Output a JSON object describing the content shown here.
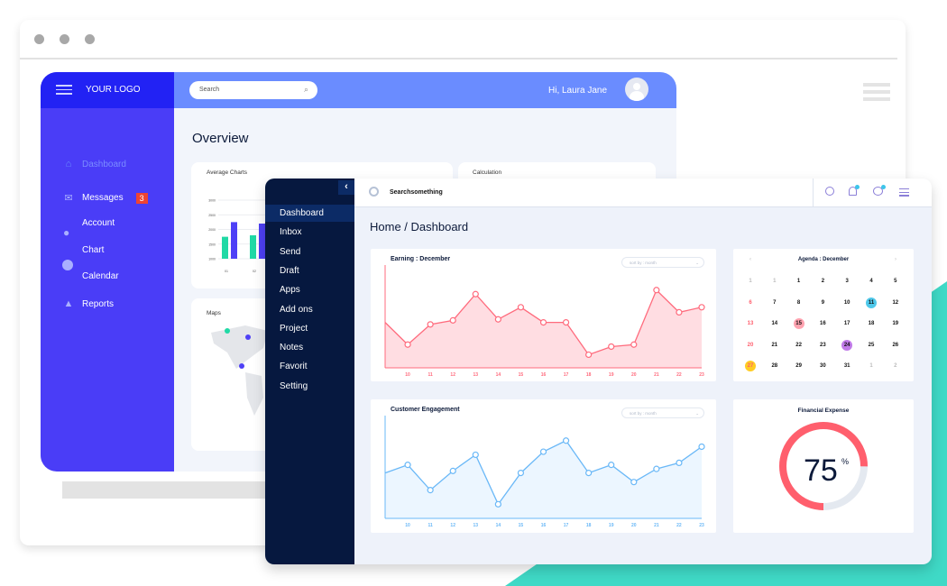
{
  "colors": {
    "teal": "#3fd9c6",
    "back_sidebar": "#4a3df7",
    "back_header": "#6a8cff",
    "front_sidebar": "#06183f",
    "earning": "#ff6b7d",
    "engagement": "#6ab8f7",
    "bar_green": "#20d9a5",
    "bar_blue": "#4e40f6",
    "donut": "#ff5f6d"
  },
  "back": {
    "logo": "YOUR LOGO",
    "search_placeholder": "Search",
    "greeting": "Hi, Laura Jane",
    "title": "Overview",
    "nav": [
      {
        "label": "Dashboard",
        "icon": "home-icon",
        "active": true
      },
      {
        "label": "Messages",
        "icon": "mail-icon",
        "badge": "3"
      },
      {
        "label": "Account",
        "icon": "user-icon"
      },
      {
        "label": "Chart",
        "icon": "pie-chart-icon"
      },
      {
        "label": "Calendar"
      },
      {
        "label": "Reports",
        "icon": "warning-icon"
      }
    ],
    "avg_title": "Average Charts",
    "calc_title": "Calculation",
    "maps_title": "Maps",
    "avg_chart": {
      "type": "bar",
      "y_ticks": [
        "3000",
        "2500",
        "2000",
        "1500",
        "1000"
      ],
      "ylim": [
        1000,
        3000
      ],
      "categories": [
        "01",
        "02"
      ],
      "series": [
        {
          "values": [
            1750,
            1800
          ]
        },
        {
          "values": [
            2250,
            2200
          ]
        }
      ]
    }
  },
  "front": {
    "search_placeholder": "Searchsomething",
    "breadcrumb": "Home / Dashboard",
    "nav": [
      "Dashboard",
      "Inbox",
      "Send",
      "Draft",
      "Apps",
      "Add ons",
      "Project",
      "Notes",
      "Favorit",
      "Setting"
    ],
    "earning": {
      "title": "Earning : December",
      "sort": "sort by : month"
    },
    "engagement": {
      "title": "Customer Engagement",
      "sort": "sort by : month"
    },
    "agenda": {
      "title": "Agenda : December",
      "prev": "‹",
      "next": "›",
      "days": [
        [
          "1",
          "1",
          "1",
          "2",
          "3",
          "4",
          "5"
        ],
        [
          "6",
          "7",
          "8",
          "9",
          "10",
          "11",
          "12"
        ],
        [
          "13",
          "14",
          "15",
          "16",
          "17",
          "18",
          "19"
        ],
        [
          "20",
          "21",
          "22",
          "23",
          "24",
          "25",
          "26"
        ],
        [
          "27",
          "28",
          "29",
          "30",
          "31",
          "1",
          "2"
        ]
      ],
      "highlights": {
        "11": "#4fc8ea",
        "15": "#ffa3b0",
        "24": "#c07ae8",
        "27": "#ffcc22"
      }
    },
    "expense": {
      "title": "Financial Expense",
      "value": "75",
      "unit": "%",
      "percent": 75
    }
  },
  "chart_data": [
    {
      "type": "area",
      "title": "Earning : December",
      "x": [
        "",
        "10",
        "11",
        "12",
        "13",
        "14",
        "15",
        "16",
        "17",
        "18",
        "19",
        "20",
        "21",
        "22",
        "23"
      ],
      "values": [
        45,
        23,
        43,
        47,
        73,
        48,
        60,
        45,
        45,
        13,
        21,
        23,
        77,
        55,
        60
      ],
      "ylim": [
        0,
        100
      ]
    },
    {
      "type": "area",
      "title": "Customer Engagement",
      "x": [
        "",
        "10",
        "11",
        "12",
        "13",
        "14",
        "15",
        "16",
        "17",
        "18",
        "19",
        "20",
        "21",
        "22",
        "23"
      ],
      "values": [
        45,
        53,
        28,
        47,
        63,
        14,
        45,
        66,
        77,
        45,
        53,
        36,
        49,
        55,
        71
      ],
      "ylim": [
        0,
        100
      ]
    }
  ]
}
